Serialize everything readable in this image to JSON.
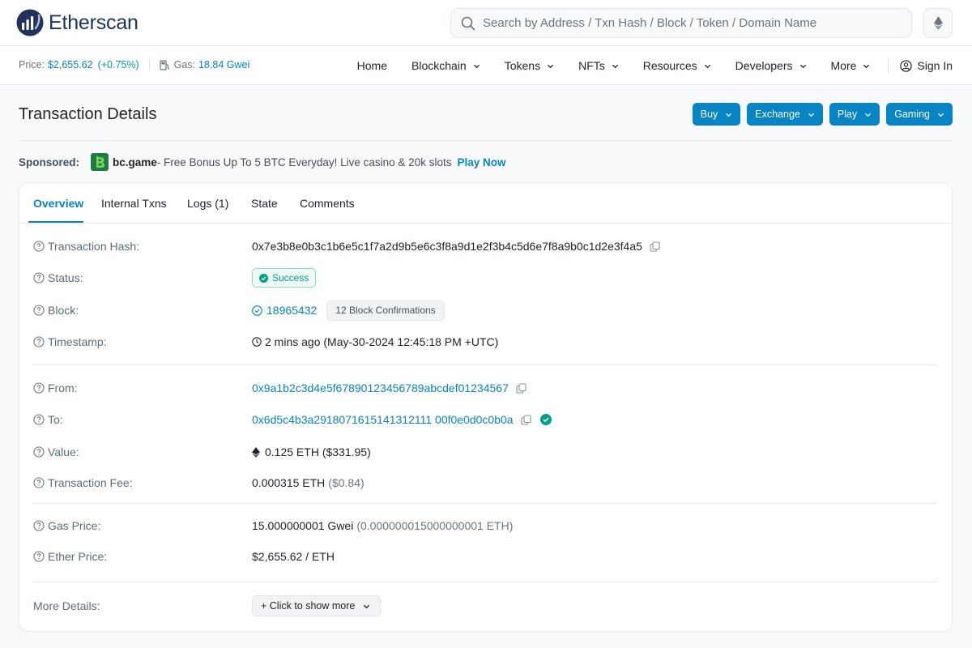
{
  "header": {
    "logo_text": "Etherscan",
    "search_placeholder": "Search by Address / Txn Hash / Block / Token / Domain Name"
  },
  "navbar": {
    "price_label": "Price:",
    "price_value": "$2,655.62",
    "price_change": "(+0.75%)",
    "gas_label": "Gas:",
    "gas_value": "18.84 Gwei",
    "items": [
      "Home",
      "Blockchain",
      "Tokens",
      "NFTs",
      "Resources",
      "Developers",
      "More"
    ],
    "sign_in": "Sign In"
  },
  "page": {
    "title": "Transaction Details",
    "buttons": [
      "Buy",
      "Exchange",
      "Play",
      "Gaming"
    ]
  },
  "sponsored": {
    "label": "Sponsored:",
    "brand": "bc.game",
    "text": " - Free Bonus Up To 5 BTC Everyday! Live casino & 20k slots",
    "link": "Play Now"
  },
  "tabs": [
    "Overview",
    "Internal Txns",
    "Logs (1)",
    "State",
    "Comments"
  ],
  "details": {
    "tx_hash_label": "Transaction Hash:",
    "tx_hash": "0x7e3b8e0b3c1b6e5c1f7a2d9b5e6c3f8a9d1e2f3b4c5d6e7f8a9b0c1d2e3f4a5",
    "status_label": "Status:",
    "status": "Success",
    "block_label": "Block:",
    "block": "18965432",
    "confirmations": "12 Block Confirmations",
    "timestamp_label": "Timestamp:",
    "timestamp": "2 mins ago (May-30-2024 12:45:18 PM +UTC)",
    "from_label": "From:",
    "from": "0x9a1b2c3d4e5f67890123456789abcdef01234567",
    "to_label": "To:",
    "to": "0x6d5c4b3a2918071615141312111 00f0e0d0c0b0a",
    "value_label": "Value:",
    "value": "0.125 ETH ($331.95)",
    "fee_label": "Transaction Fee:",
    "fee": "0.000315 ETH",
    "fee_usd": "($0.84)",
    "gas_price_label": "Gas Price:",
    "gas_price": "15.000000001 Gwei",
    "gas_price_eth": "(0.000000015000000001 ETH)",
    "ether_price_label": "Ether Price:",
    "ether_price": "$2,655.62 / ETH",
    "more_label": "More Details:",
    "more_button": "+ Click to show more"
  },
  "colors": {
    "accent": "#0784c3",
    "success": "#00a186",
    "brand_dark": "#21325b"
  }
}
